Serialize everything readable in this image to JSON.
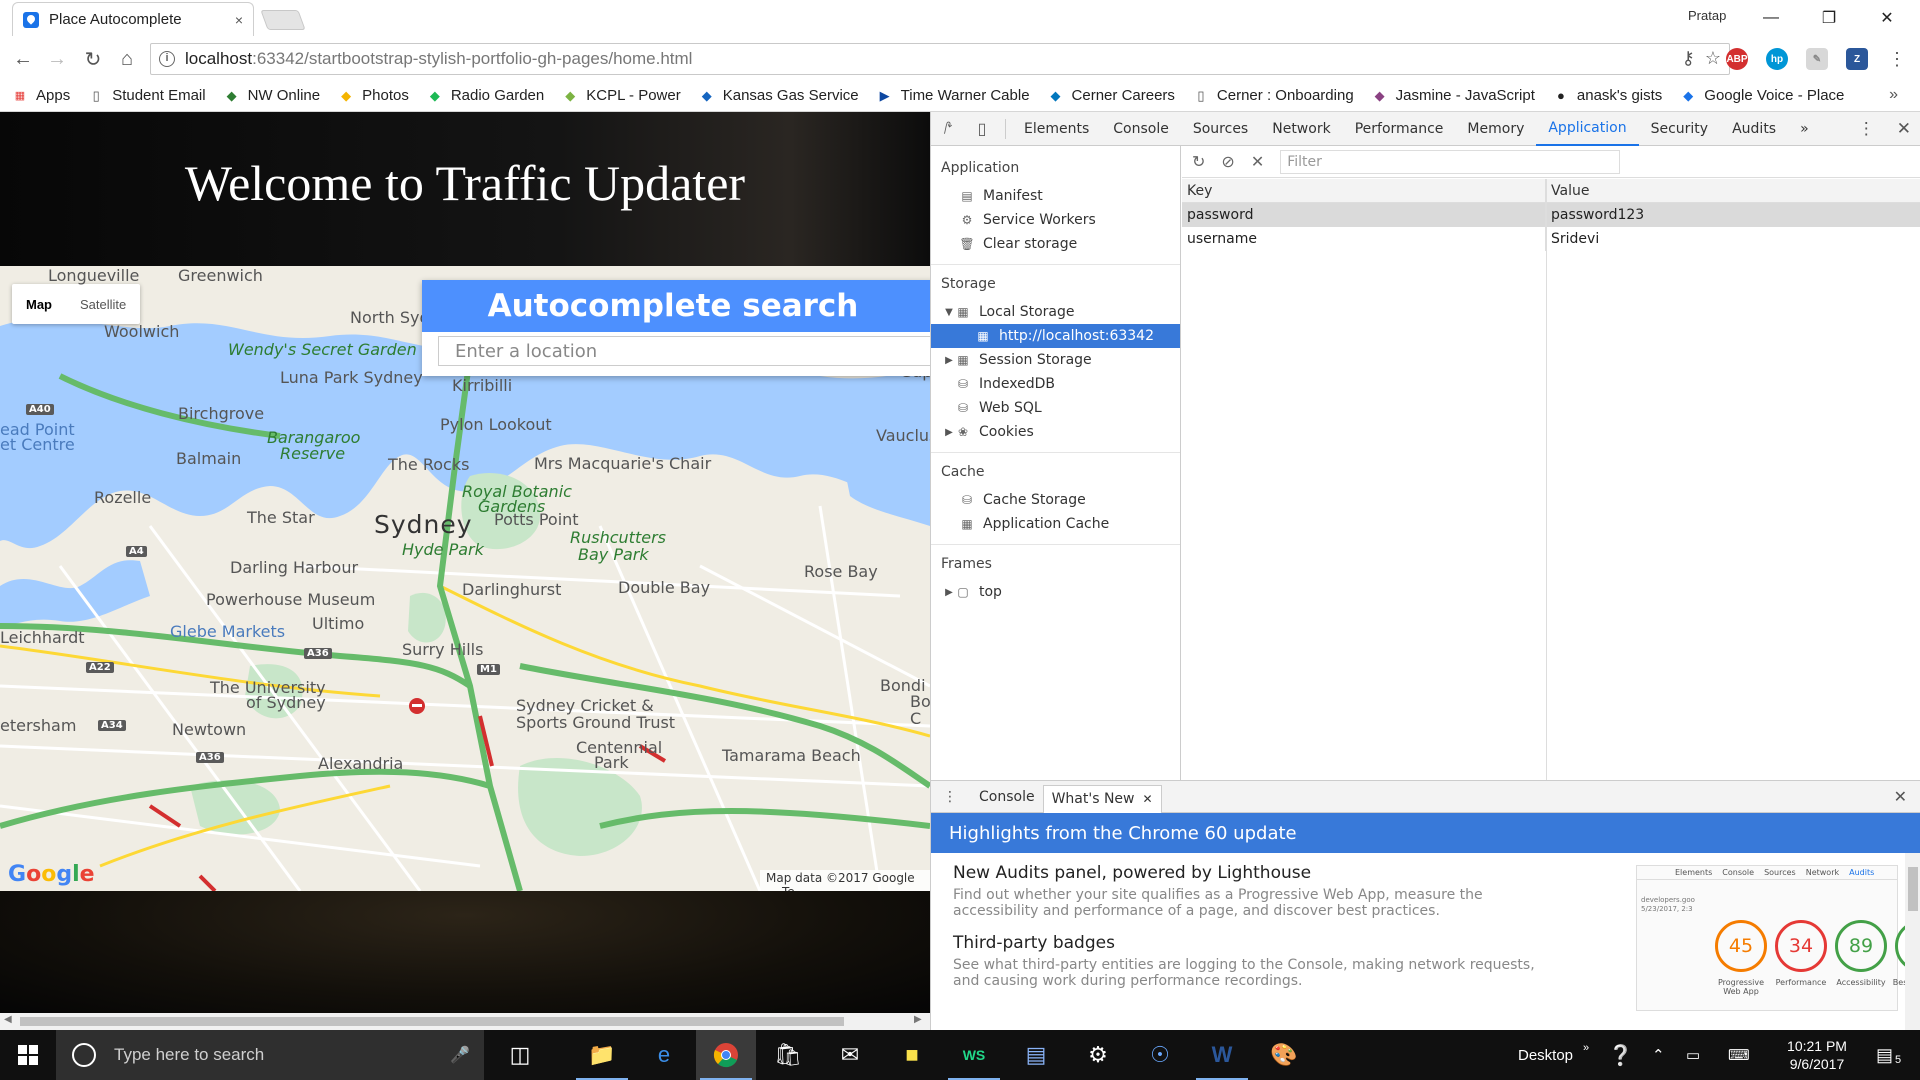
{
  "browser": {
    "tab_title": "Place Autocomplete",
    "tab_close": "×",
    "profile_name": "Pratap",
    "url_host": "localhost",
    "url_path": ":63342/startbootstrap-stylish-portfolio-gh-pages/home.html",
    "bookmarks_label": "Apps",
    "bookmarks": [
      {
        "label": "Student Email",
        "icon": "page-icon",
        "color": "#555"
      },
      {
        "label": "NW Online",
        "icon": "nw-icon",
        "color": "#2e7d32"
      },
      {
        "label": "Photos",
        "icon": "pinwheel-icon",
        "color": "#f4b400"
      },
      {
        "label": "Radio Garden",
        "icon": "dot-icon",
        "color": "#1db954"
      },
      {
        "label": "KCPL - Power",
        "icon": "kcpl-icon",
        "color": "#7cb342"
      },
      {
        "label": "Kansas Gas Service",
        "icon": "kgs-icon",
        "color": "#1565c0"
      },
      {
        "label": "Time Warner Cable",
        "icon": "play-icon",
        "color": "#0d47a1"
      },
      {
        "label": "Cerner Careers",
        "icon": "bulb-icon",
        "color": "#0277bd"
      },
      {
        "label": "Cerner : Onboarding",
        "icon": "page-icon",
        "color": "#555"
      },
      {
        "label": "Jasmine - JavaScript",
        "icon": "jasmine-icon",
        "color": "#8a4182"
      },
      {
        "label": "anask's gists",
        "icon": "github-icon",
        "color": "#222"
      },
      {
        "label": "Google Voice - Place",
        "icon": "voice-icon",
        "color": "#1a73e8"
      }
    ],
    "bookmarks_more": "»"
  },
  "page": {
    "hero_title": "Welcome to Traffic Updater",
    "map_type": {
      "map": "Map",
      "satellite": "Satellite"
    },
    "autocomplete": {
      "heading": "Autocomplete search",
      "placeholder": "Enter a location"
    },
    "map_labels": [
      "Longueville",
      "Greenwich",
      "Woolwich",
      "North Syd",
      "Wendy's Secret Garden",
      "Luna Park Sydney",
      "Kirribilli",
      "A40",
      "Birchgrove",
      "Barangaroo",
      "Reserve",
      "Pylon Lookout",
      "Balmain",
      "ead Point",
      "et Centre",
      "The Rocks",
      "Mrs Macquarie's Chair",
      "Vaucluse",
      "Royal Botanic",
      "Gardens",
      "Rozelle",
      "The Star",
      "Sydney",
      "Potts Point",
      "Rushcutters",
      "Bay Park",
      "Hyde Park",
      "A4",
      "Darling Harbour",
      "Rose Bay",
      "Darlinghurst",
      "Double Bay",
      "Powerhouse Museum",
      "Leichhardt",
      "Glebe Markets",
      "Ultimo",
      "A36",
      "Surry Hills",
      "M1",
      "A22",
      "The University",
      "of Sydney",
      "Bondi E",
      "etersham",
      "A34",
      "Newtown",
      "Sydney Cricket &",
      "Sports Ground Trust",
      "Centennial",
      "Park",
      "Tamarama Beach",
      "Alexandria",
      "A36",
      "Gap",
      "Bo",
      "C"
    ],
    "google_logo": [
      "G",
      "o",
      "o",
      "g",
      "l",
      "e"
    ],
    "map_attribution": "Map data ©2017 Google",
    "map_attribution_tail": "Te"
  },
  "devtools": {
    "tabs": [
      "Elements",
      "Console",
      "Sources",
      "Network",
      "Performance",
      "Memory",
      "Application",
      "Security",
      "Audits"
    ],
    "active_tab": "Application",
    "more_tabs": "»",
    "sidebar": {
      "application_header": "Application",
      "application_items": [
        "Manifest",
        "Service Workers",
        "Clear storage"
      ],
      "storage_header": "Storage",
      "storage_items": [
        {
          "label": "Local Storage",
          "expanded": true
        },
        {
          "label": "http://localhost:63342",
          "selected": true
        },
        {
          "label": "Session Storage",
          "expanded": false
        },
        {
          "label": "IndexedDB"
        },
        {
          "label": "Web SQL"
        },
        {
          "label": "Cookies",
          "expanded": false
        }
      ],
      "cache_header": "Cache",
      "cache_items": [
        "Cache Storage",
        "Application Cache"
      ],
      "frames_header": "Frames",
      "frames_items": [
        "top"
      ]
    },
    "filter_placeholder": "Filter",
    "table": {
      "headers": {
        "key": "Key",
        "value": "Value"
      },
      "rows": [
        {
          "key": "password",
          "value": "password123"
        },
        {
          "key": "username",
          "value": "Sridevi"
        }
      ]
    },
    "drawer": {
      "tabs": [
        "Console",
        "What's New"
      ],
      "active_tab": "What's New",
      "banner": "Highlights from the Chrome 60 update",
      "items": [
        {
          "title": "New Audits panel, powered by Lighthouse",
          "desc": "Find out whether your site qualifies as a Progressive Web App, measure the accessibility and performance of a page, and discover best practices."
        },
        {
          "title": "Third-party badges",
          "desc": "See what third-party entities are logging to the Console, making network requests, and causing work during performance recordings."
        }
      ],
      "thumb": {
        "tabs": [
          "Elements",
          "Console",
          "Sources",
          "Network",
          "Audits"
        ],
        "host": "developers.goo",
        "date": "5/23/2017, 2:3",
        "scores": [
          {
            "value": "45",
            "label": "Progressive Web App",
            "color": "#f57c00"
          },
          {
            "value": "34",
            "label": "Performance",
            "color": "#e53935"
          },
          {
            "value": "89",
            "label": "Accessibility",
            "color": "#43a047"
          },
          {
            "value": "",
            "label": "Best Practices",
            "color": "#43a047"
          }
        ]
      }
    }
  },
  "taskbar": {
    "search_placeholder": "Type here to search",
    "desktop_label": "Desktop",
    "time": "10:21 PM",
    "date": "9/6/2017",
    "notification_count": "5"
  }
}
